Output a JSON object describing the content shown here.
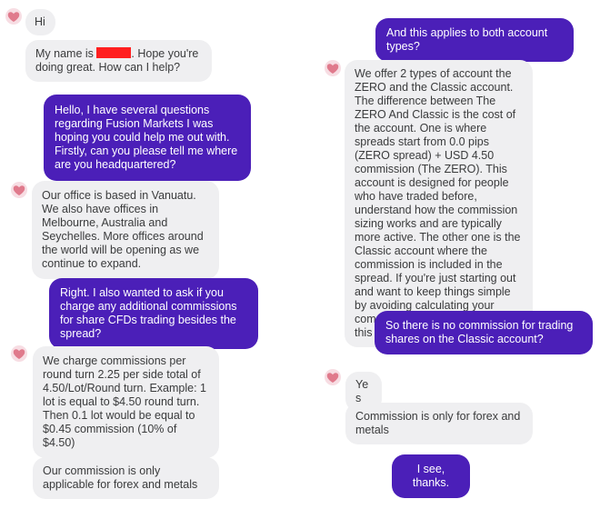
{
  "chat": {
    "messages": {
      "m1": "Hi",
      "m2_prefix": "My name is",
      "m2_suffix": ". Hope you're doing great. How can I help?",
      "m3": "Hello, I have several questions regarding Fusion Markets I was hoping you could help me out with. Firstly, can you please tell me where are you headquartered?",
      "m4": "Our office is based in Vanuatu. We also have offices in Melbourne, Australia and Seychelles. More offices around the world will be opening as we continue to expand.",
      "m5": "Right. I also wanted to ask if you charge any additional commissions for share CFDs trading besides the spread?",
      "m6": "We charge commissions per round turn 2.25 per side total of 4.50/Lot/Round turn. Example: 1 lot is equal to $4.50 round turn. Then 0.1 lot would be equal to $0.45 commission (10% of $4.50)",
      "m7": "Our commission is only applicable for forex and metals",
      "m8": "And this applies to both account types?",
      "m9": "We offer 2 types of account the ZERO and the Classic account. The difference between The ZERO And Classic is the cost of the account. One is where spreads start from 0.0 pips (ZERO spread) + USD 4.50 commission (The ZERO). This account is designed for people who have traded before, understand how the commission sizing works and are typically more active. The other one is the Classic account where the commission is included in the spread. If you're just starting out and want to keep things simple by avoiding calculating your commission before each trade, this is the best one for you.",
      "m10": "So there is no commission for trading shares on the Classic account?",
      "m11": "Yes",
      "m12": "Commission is only for forex and metals",
      "m13": "I see, thanks."
    },
    "colors": {
      "incoming_bubble": "#efeff1",
      "outgoing_bubble": "#4b1fb8",
      "redaction": "#ff1f1f",
      "avatar_heart": "#e07a8c"
    },
    "icons": {
      "avatar": "heart-avatar-icon"
    }
  }
}
